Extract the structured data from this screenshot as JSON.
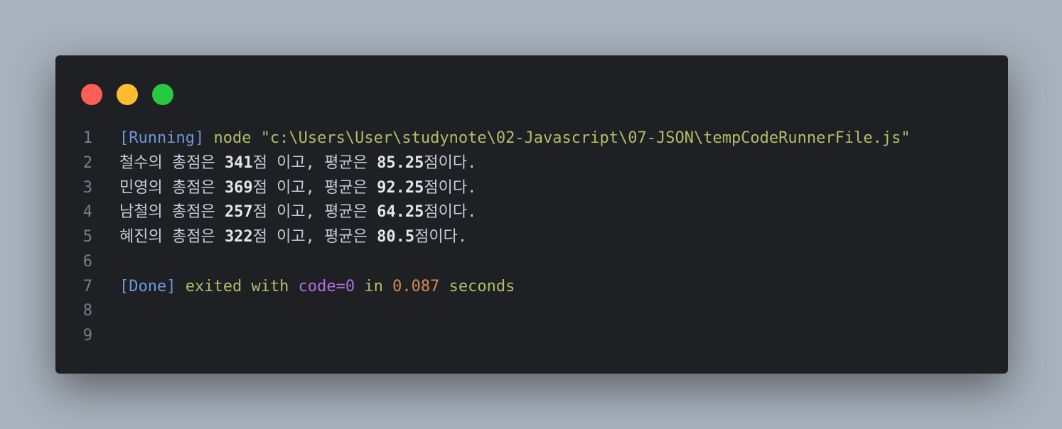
{
  "window": {
    "controls": [
      {
        "name": "close",
        "color": "#ff5f57"
      },
      {
        "name": "minimize",
        "color": "#febc2e"
      },
      {
        "name": "maximize",
        "color": "#28c840"
      }
    ]
  },
  "lines": [
    {
      "n": "1",
      "running": "[Running]",
      "cmd": " node \"c:\\Users\\User\\studynote\\02-Javascript\\07-JSON\\tempCodeRunnerFile.js\""
    },
    {
      "n": "2",
      "a": "철수의 총점은 ",
      "total": "341",
      "b": "점 이고, 평균은 ",
      "avg": "85.25",
      "c": "점이다."
    },
    {
      "n": "3",
      "a": "민영의 총점은 ",
      "total": "369",
      "b": "점 이고, 평균은 ",
      "avg": "92.25",
      "c": "점이다."
    },
    {
      "n": "4",
      "a": "남철의 총점은 ",
      "total": "257",
      "b": "점 이고, 평균은 ",
      "avg": "64.25",
      "c": "점이다."
    },
    {
      "n": "5",
      "a": "혜진의 총점은 ",
      "total": "322",
      "b": "점 이고, 평균은 ",
      "avg": "80.5",
      "c": "점이다."
    },
    {
      "n": "6"
    },
    {
      "n": "7",
      "done": "[Done]",
      "exited": " exited with ",
      "code": "code=0",
      "in": " in ",
      "time": "0.087",
      "seconds": " seconds"
    },
    {
      "n": "8"
    },
    {
      "n": "9"
    }
  ]
}
